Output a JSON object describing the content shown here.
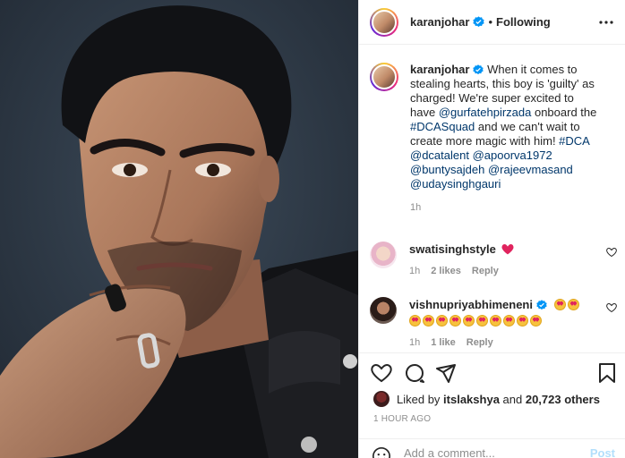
{
  "post": {
    "username": "karanjohar",
    "follow_state": "Following",
    "dot": "•",
    "caption": {
      "username": "karanjohar",
      "text_1": " When it comes to stealing hearts, this boy is 'guilty' as charged! We're super excited to have ",
      "mention_1": "@gurfatehpirzada",
      "text_2": " onboard the ",
      "tag_1": "#DCASquad",
      "text_3": " and we can't wait to create more magic with him! ",
      "tag_2": "#DCA",
      "mention_2": "@dcatalent",
      "mention_3": "@apoorva1972",
      "mention_4": "@buntysajdeh",
      "mention_5": "@rajeevmasand",
      "mention_6": "@udaysinghgauri",
      "time": "1h"
    },
    "comments": [
      {
        "username": "swatisinghstyle",
        "time": "1h",
        "likes": "2 likes",
        "reply": "Reply"
      },
      {
        "username": "vishnupriyabhimeneni",
        "time": "1h",
        "likes": "1 like",
        "reply": "Reply"
      }
    ],
    "liked_by_prefix": "Liked by ",
    "liked_by_user": "itslakshya",
    "liked_by_and": " and ",
    "liked_by_count": "20,723 others",
    "timestamp": "1 hour ago",
    "add_comment_placeholder": "Add a comment...",
    "post_button": "Post"
  },
  "colors": {
    "link": "#00376b",
    "verified": "#0095f6",
    "muted": "#8e8e8e",
    "post_disabled": "#b2dffc",
    "heart": "#e0245e"
  },
  "icons": [
    "verified-badge-icon",
    "more-options-icon",
    "heart-icon",
    "comment-icon",
    "share-icon",
    "bookmark-icon",
    "emoji-icon",
    "red-heart-emoji",
    "heart-eyes-emoji"
  ]
}
